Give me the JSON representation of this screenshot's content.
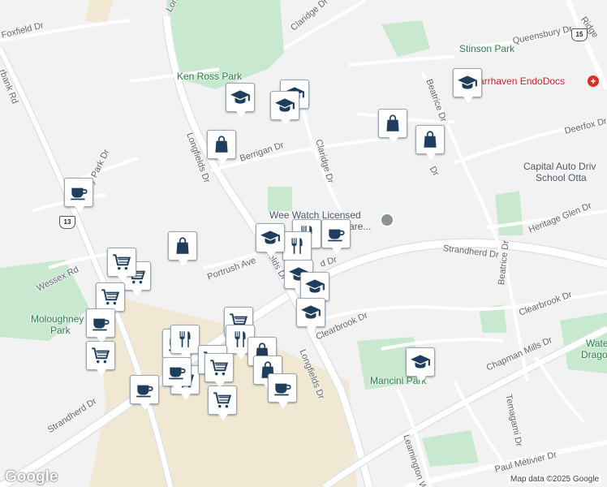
{
  "map": {
    "colors": {
      "background": "#f2f2f2",
      "park": "#c8e8cf",
      "commercial": "#f1e8d3",
      "road": "#ffffff",
      "arterial": "#e3e6ea",
      "pin_icon": "#1f3d5c",
      "park_text": "#2e7d4f",
      "medical_text": "#c5221f"
    },
    "streets": {
      "foxfield": "Foxfield Dr",
      "longfields_top": "Longfields Dr",
      "longfields_mid": "Longfields Dr",
      "longfields_bottom": "Longfields Dr",
      "claridge_top": "Claridge Dr",
      "claridge_mid": "Claridge Dr",
      "ridgefield": "Ridge",
      "queensbury": "Queensbury Dr",
      "beatrice_top": "Beatrice Dr",
      "beatrice_mid": "Beatrice Dr",
      "deerfox": "Deerfox Dr",
      "berrigan": "Berrigan Dr",
      "berrigan_dr_tail": "Dr",
      "heritage_glen": "Heritage Glen Dr",
      "strandherd_east": "Strandherd Dr",
      "strandherd_west": "Strandherd Dr",
      "portrush": "Portrush Ave",
      "clearbrook_east": "Clearbrook Dr",
      "clearbrook_west": "Clearbrook Dr",
      "chapman_mills": "Chapman Mills Dr",
      "temagami": "Temagami Dr",
      "leamington": "Leamington Way",
      "paul_metivier": "Paul Métivier Dr",
      "wessex": "Wessex Rd",
      "fairbank": "rbank Rd",
      "country_park": "y Park Dr",
      "dr_fragment": "d Dr"
    },
    "parks": {
      "ken_ross": "Ken Ross Park",
      "stinson": "Stinson Park",
      "moloughney_1": "Moloughney",
      "moloughney_2": "Park",
      "mancini": "Mancini Park",
      "water_dragon_1": "Wate",
      "water_dragon_2": "Dragon"
    },
    "places": {
      "endodocs": "arrhaven EndoDocs",
      "capital_auto_1": "Capital Auto Driv",
      "capital_auto_2": "School Otta",
      "wee_watch_1": "Wee Watch Licensed",
      "wee_watch_2": "are..."
    },
    "highway_shields": [
      "15",
      "13"
    ],
    "pins": [
      {
        "type": "school",
        "icon": "school-cap-icon"
      },
      {
        "type": "school",
        "icon": "school-cap-icon"
      },
      {
        "type": "school",
        "icon": "school-cap-icon"
      },
      {
        "type": "shopping",
        "icon": "shopping-bag-icon"
      },
      {
        "type": "shopping",
        "icon": "shopping-bag-icon"
      },
      {
        "type": "shopping",
        "icon": "shopping-bag-icon"
      },
      {
        "type": "cafe",
        "icon": "coffee-cup-icon"
      },
      {
        "type": "school",
        "icon": "school-cap-icon"
      },
      {
        "type": "restaurant",
        "icon": "fork-knife-icon"
      },
      {
        "type": "restaurant",
        "icon": "fork-knife-icon"
      },
      {
        "type": "cafe",
        "icon": "coffee-cup-icon"
      },
      {
        "type": "shopping",
        "icon": "shopping-bag-icon"
      },
      {
        "type": "school",
        "icon": "school-cap-icon"
      },
      {
        "type": "school",
        "icon": "school-cap-icon"
      },
      {
        "type": "school",
        "icon": "school-cap-icon"
      },
      {
        "type": "grocery",
        "icon": "shopping-cart-icon"
      },
      {
        "type": "grocery",
        "icon": "shopping-cart-icon"
      },
      {
        "type": "grocery",
        "icon": "shopping-cart-icon"
      },
      {
        "type": "grocery",
        "icon": "shopping-cart-icon"
      },
      {
        "type": "cafe",
        "icon": "coffee-cup-icon"
      },
      {
        "type": "cafe",
        "icon": "coffee-cup-icon"
      },
      {
        "type": "school",
        "icon": "school-cap-icon"
      },
      {
        "type": "grocery",
        "icon": "shopping-cart-icon"
      },
      {
        "type": "restaurant",
        "icon": "fork-knife-icon"
      },
      {
        "type": "restaurant",
        "icon": "fork-knife-icon"
      },
      {
        "type": "cafe",
        "icon": "coffee-cup-icon"
      },
      {
        "type": "grocery",
        "icon": "shopping-cart-icon"
      },
      {
        "type": "grocery",
        "icon": "shopping-cart-icon"
      },
      {
        "type": "shopping",
        "icon": "shopping-bag-icon"
      },
      {
        "type": "shopping",
        "icon": "shopping-bag-icon"
      },
      {
        "type": "cafe",
        "icon": "coffee-cup-icon"
      },
      {
        "type": "cafe",
        "icon": "coffee-cup-icon"
      },
      {
        "type": "grocery",
        "icon": "shopping-cart-icon"
      },
      {
        "type": "grocery",
        "icon": "shopping-cart-icon"
      },
      {
        "type": "school",
        "icon": "school-cap-icon"
      }
    ],
    "branding": {
      "logo": "Google",
      "attribution": "Map data ©2025 Google"
    }
  }
}
